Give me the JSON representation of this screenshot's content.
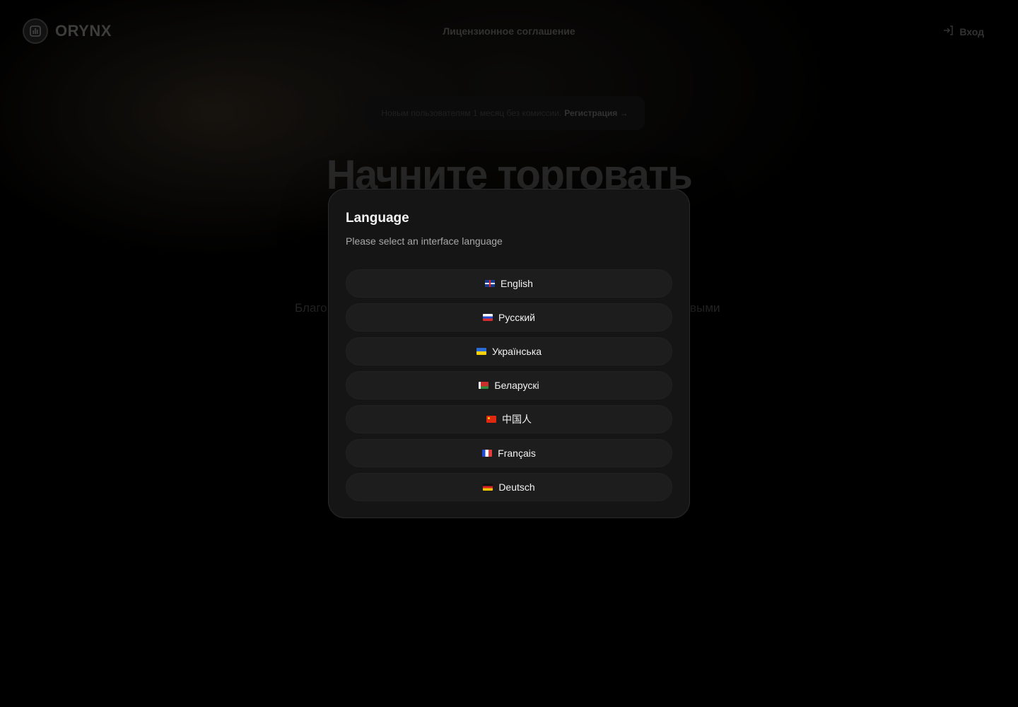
{
  "header": {
    "logo_text": "ORYNX",
    "center_link": "Лицензионное соглашение",
    "login_label": "Вход"
  },
  "promo": {
    "text": "Новым пользователям 1 месяц без комиссии.",
    "link": "Регистрация →"
  },
  "hero": {
    "title": "Начните торговать",
    "subtitle_left": "Благо",
    "subtitle_right": "выми"
  },
  "modal": {
    "title": "Language",
    "description": "Please select an interface language",
    "languages": [
      {
        "label": "English",
        "flag": "gb-flag-icon"
      },
      {
        "label": "Русский",
        "flag": "ru-flag-icon"
      },
      {
        "label": "Українська",
        "flag": "ua-flag-icon"
      },
      {
        "label": "Беларускі",
        "flag": "by-flag-icon"
      },
      {
        "label": "中国人",
        "flag": "cn-flag-icon"
      },
      {
        "label": "Français",
        "flag": "fr-flag-icon"
      },
      {
        "label": "Deutsch",
        "flag": "de-flag-icon"
      }
    ]
  }
}
